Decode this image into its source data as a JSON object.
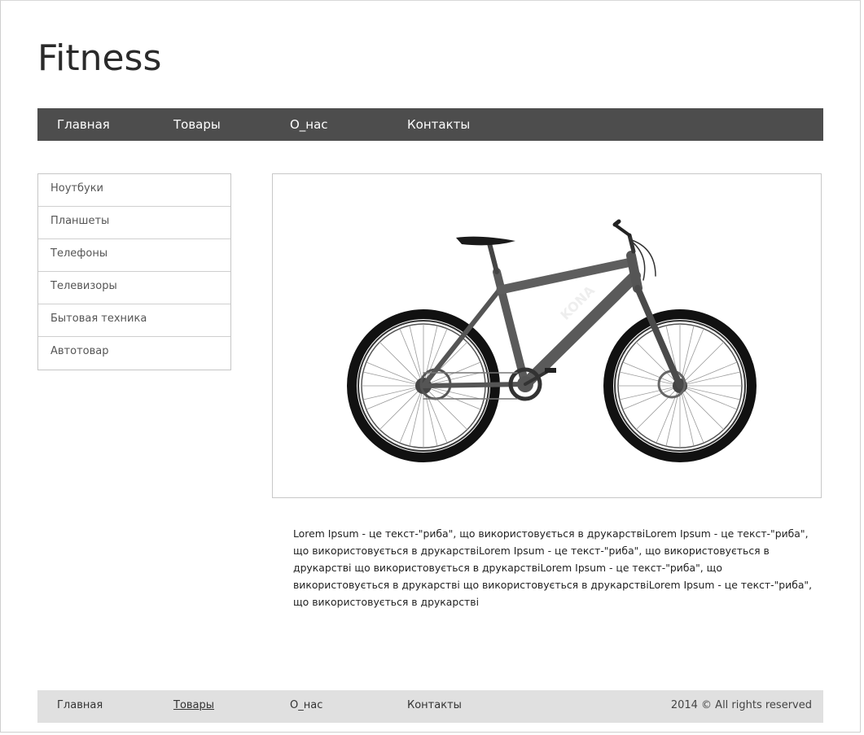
{
  "site": {
    "logo": "Fitness"
  },
  "nav": {
    "items": [
      {
        "label": "Главная"
      },
      {
        "label": "Товары"
      },
      {
        "label": "О_нас"
      },
      {
        "label": "Контакты"
      }
    ]
  },
  "sidebar": {
    "items": [
      {
        "label": "Ноутбуки"
      },
      {
        "label": "Планшеты"
      },
      {
        "label": "Телефоны"
      },
      {
        "label": "Телевизоры"
      },
      {
        "label": "Бытовая техника"
      },
      {
        "label": "Автотовар"
      }
    ]
  },
  "product": {
    "image": "mountain-bike-image",
    "description": "Lorem Ipsum - це текст-\"риба\", що використовується в друкарствіLorem Ipsum - це текст-\"риба\", що використовується в друкарствіLorem Ipsum - це текст-\"риба\", що використовується в друкарстві що використовується в друкарствіLorem Ipsum - це текст-\"риба\", що використовується в друкарстві що використовується в друкарствіLorem Ipsum - це текст-\"риба\", що використовується в друкарстві"
  },
  "footer": {
    "items": [
      {
        "label": "Главная"
      },
      {
        "label": "Товары"
      },
      {
        "label": "О_нас"
      },
      {
        "label": "Контакты"
      }
    ],
    "copyright": "2014 © All rights reserved"
  },
  "colors": {
    "nav_background": "#4d4d4d",
    "footer_background": "#e0e0e0",
    "border": "#c6c6c6"
  }
}
